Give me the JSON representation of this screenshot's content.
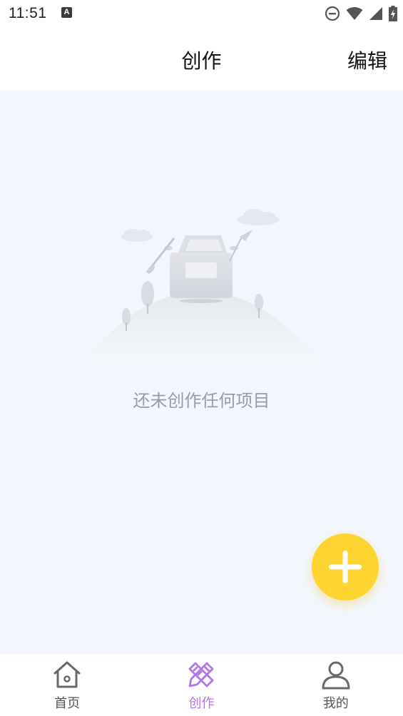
{
  "status_bar": {
    "time": "11:51",
    "notification_icon": "a-icon",
    "icons": [
      "do-not-disturb-icon",
      "wifi-icon",
      "signal-icon",
      "battery-charging-icon"
    ]
  },
  "header": {
    "title": "创作",
    "edit_label": "编辑"
  },
  "content": {
    "empty_message": "还未创作任何项目",
    "fab_icon": "plus-icon"
  },
  "bottom_nav": {
    "items": [
      {
        "label": "首页",
        "icon": "home-icon",
        "active": false
      },
      {
        "label": "创作",
        "icon": "pencil-ruler-icon",
        "active": true
      },
      {
        "label": "我的",
        "icon": "person-icon",
        "active": false
      }
    ]
  },
  "colors": {
    "content_background": "#f3f7fd",
    "fab": "#fdd430",
    "active_nav": "#b077e8",
    "inactive_nav": "#555555",
    "empty_text": "#9a9ca3"
  }
}
